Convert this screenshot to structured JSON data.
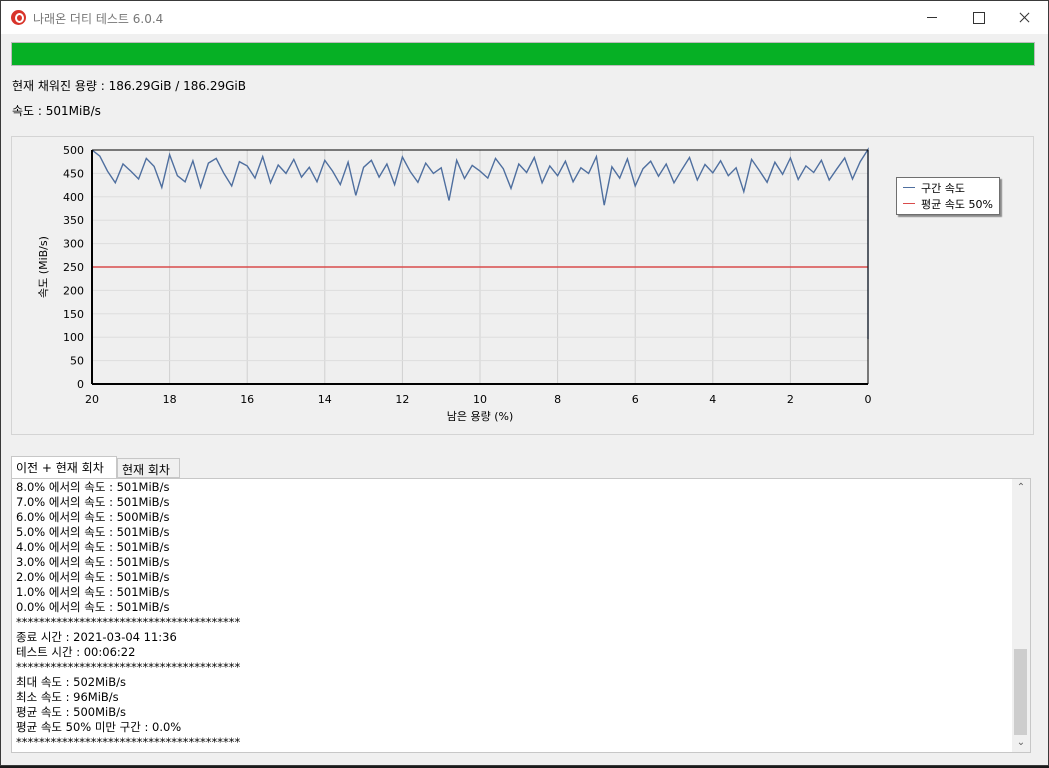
{
  "window": {
    "title": "나래온 더티 테스트 6.0.4"
  },
  "progress": {
    "fraction": 1.0,
    "color": "#06b025"
  },
  "info": {
    "capacity": "현재 채워진 용량 : 186.29GiB / 186.29GiB",
    "speed": "속도 : 501MiB/s"
  },
  "chart_data": {
    "type": "line",
    "xlabel": "남은 용량 (%)",
    "ylabel": "속도 (MiB/s)",
    "xlim": [
      20,
      0
    ],
    "ylim": [
      0,
      500
    ],
    "x_ticks": [
      "20",
      "18",
      "16",
      "14",
      "12",
      "10",
      "8",
      "6",
      "4",
      "2",
      "0"
    ],
    "y_ticks": [
      "500",
      "450",
      "400",
      "350",
      "300",
      "250",
      "200",
      "150",
      "100",
      "50",
      "0"
    ],
    "grid": true,
    "legend_position": "right",
    "series": [
      {
        "name": "구간 속도",
        "color": "#4f6f9f",
        "points": [
          [
            20,
            500
          ],
          [
            19.8,
            487
          ],
          [
            19.6,
            455
          ],
          [
            19.4,
            430
          ],
          [
            19.2,
            470
          ],
          [
            19.0,
            455
          ],
          [
            18.8,
            438
          ],
          [
            18.6,
            482
          ],
          [
            18.4,
            465
          ],
          [
            18.2,
            420
          ],
          [
            18.0,
            490
          ],
          [
            17.8,
            445
          ],
          [
            17.6,
            432
          ],
          [
            17.4,
            477
          ],
          [
            17.2,
            420
          ],
          [
            17.0,
            472
          ],
          [
            16.8,
            482
          ],
          [
            16.6,
            450
          ],
          [
            16.4,
            423
          ],
          [
            16.2,
            475
          ],
          [
            16.0,
            466
          ],
          [
            15.8,
            440
          ],
          [
            15.6,
            486
          ],
          [
            15.4,
            430
          ],
          [
            15.2,
            468
          ],
          [
            15.0,
            450
          ],
          [
            14.8,
            480
          ],
          [
            14.6,
            442
          ],
          [
            14.4,
            463
          ],
          [
            14.2,
            432
          ],
          [
            14.0,
            478
          ],
          [
            13.8,
            455
          ],
          [
            13.6,
            426
          ],
          [
            13.4,
            474
          ],
          [
            13.2,
            403
          ],
          [
            13.0,
            463
          ],
          [
            12.8,
            478
          ],
          [
            12.6,
            442
          ],
          [
            12.4,
            470
          ],
          [
            12.2,
            426
          ],
          [
            12.0,
            485
          ],
          [
            11.8,
            454
          ],
          [
            11.6,
            431
          ],
          [
            11.4,
            472
          ],
          [
            11.2,
            450
          ],
          [
            11.0,
            462
          ],
          [
            10.8,
            392
          ],
          [
            10.6,
            478
          ],
          [
            10.4,
            439
          ],
          [
            10.2,
            467
          ],
          [
            10.0,
            455
          ],
          [
            9.8,
            440
          ],
          [
            9.6,
            482
          ],
          [
            9.4,
            460
          ],
          [
            9.2,
            418
          ],
          [
            9.0,
            470
          ],
          [
            8.8,
            452
          ],
          [
            8.6,
            484
          ],
          [
            8.4,
            430
          ],
          [
            8.2,
            466
          ],
          [
            8.0,
            445
          ],
          [
            7.8,
            476
          ],
          [
            7.6,
            432
          ],
          [
            7.4,
            462
          ],
          [
            7.2,
            450
          ],
          [
            7.0,
            486
          ],
          [
            6.8,
            382
          ],
          [
            6.6,
            464
          ],
          [
            6.4,
            440
          ],
          [
            6.2,
            481
          ],
          [
            6.0,
            423
          ],
          [
            5.8,
            460
          ],
          [
            5.6,
            476
          ],
          [
            5.4,
            444
          ],
          [
            5.2,
            470
          ],
          [
            5.0,
            430
          ],
          [
            4.8,
            458
          ],
          [
            4.6,
            484
          ],
          [
            4.4,
            436
          ],
          [
            4.2,
            469
          ],
          [
            4.0,
            451
          ],
          [
            3.8,
            477
          ],
          [
            3.6,
            445
          ],
          [
            3.4,
            462
          ],
          [
            3.2,
            411
          ],
          [
            3.0,
            480
          ],
          [
            2.8,
            456
          ],
          [
            2.6,
            431
          ],
          [
            2.4,
            474
          ],
          [
            2.2,
            448
          ],
          [
            2.0,
            483
          ],
          [
            1.8,
            437
          ],
          [
            1.6,
            466
          ],
          [
            1.4,
            452
          ],
          [
            1.2,
            478
          ],
          [
            1.0,
            436
          ],
          [
            0.8,
            460
          ],
          [
            0.6,
            483
          ],
          [
            0.4,
            438
          ],
          [
            0.2,
            475
          ],
          [
            0.0,
            501
          ],
          [
            0.0,
            96
          ]
        ]
      },
      {
        "name": "평균 속도 50%",
        "color": "#d94b4b",
        "points": [
          [
            20,
            250
          ],
          [
            0,
            250
          ]
        ]
      }
    ]
  },
  "tabs": [
    "이전 + 현재 회차",
    "현재 회차"
  ],
  "log": [
    "8.0% 에서의 속도 : 501MiB/s",
    "7.0% 에서의 속도 : 501MiB/s",
    "6.0% 에서의 속도 : 500MiB/s",
    "5.0% 에서의 속도 : 501MiB/s",
    "4.0% 에서의 속도 : 501MiB/s",
    "3.0% 에서의 속도 : 501MiB/s",
    "2.0% 에서의 속도 : 501MiB/s",
    "1.0% 에서의 속도 : 501MiB/s",
    "0.0% 에서의 속도 : 501MiB/s",
    "***************************************",
    "종료 시간 : 2021-03-04 11:36",
    "테스트 시간 : 00:06:22",
    "***************************************",
    "최대 속도 : 502MiB/s",
    "최소 속도 : 96MiB/s",
    "평균 속도 : 500MiB/s",
    "평균 속도 50% 미만 구간 : 0.0%",
    "***************************************"
  ],
  "icons": {
    "app": "naraeon-app-icon",
    "minimize": "minimize-icon",
    "maximize": "maximize-icon",
    "close": "close-icon",
    "scroll_up": "chevron-up-icon",
    "scroll_down": "chevron-down-icon"
  }
}
